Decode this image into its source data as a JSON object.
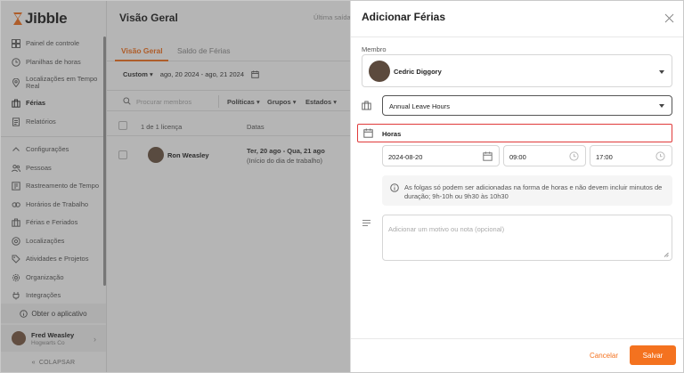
{
  "brand": {
    "name": "Jibble",
    "accent": "#f4721f"
  },
  "sidebar": {
    "items": [
      {
        "label": "Painel de controle",
        "icon": "dashboard-icon"
      },
      {
        "label": "Planilhas de horas",
        "icon": "clock-icon"
      },
      {
        "label": "Localizações em Tempo Real",
        "icon": "location-icon"
      },
      {
        "label": "Férias",
        "icon": "suitcase-icon",
        "active": true
      },
      {
        "label": "Relatórios",
        "icon": "report-icon"
      }
    ],
    "settings_items": [
      {
        "label": "Configurações",
        "icon": "chevron-up-icon"
      },
      {
        "label": "Pessoas",
        "icon": "people-icon"
      },
      {
        "label": "Rastreamento de Tempo",
        "icon": "tracking-icon"
      },
      {
        "label": "Horários de Trabalho",
        "icon": "schedule-icon"
      },
      {
        "label": "Férias e Feriados",
        "icon": "suitcase-icon"
      },
      {
        "label": "Localizações",
        "icon": "location-icon"
      },
      {
        "label": "Atividades e Projetos",
        "icon": "tag-icon"
      },
      {
        "label": "Organização",
        "icon": "gear-icon"
      },
      {
        "label": "Integrações",
        "icon": "plug-icon"
      }
    ],
    "get_app": "Obter o aplicativo",
    "user": {
      "name": "Fred Weasley",
      "org": "Hogwarts Co"
    },
    "collapse": "COLAPSAR"
  },
  "main": {
    "title": "Visão Geral",
    "last_updated": "Última saída",
    "tabs": [
      "Visão Geral",
      "Saldo de Férias"
    ],
    "period_mode": "Custom",
    "period_range": "ago, 20 2024 - ago, 21 2024",
    "search_placeholder": "Procurar membros",
    "filters": [
      "Políticas",
      "Grupos",
      "Estados"
    ],
    "table": {
      "count_label": "1 de 1 licença",
      "date_header": "Datas",
      "rows": [
        {
          "name": "Ron Weasley",
          "date_line1": "Ter, 20 ago - Qua, 21 ago",
          "date_line2": "(Início do dia de trabalho)"
        }
      ]
    }
  },
  "panel": {
    "title": "Adicionar Férias",
    "member_label": "Membro",
    "member_name": "Cedric Diggory",
    "policy": "Annual Leave Hours",
    "mode": "Horas",
    "date": "2024-08-20",
    "start_time": "09:00",
    "end_time": "17:00",
    "info": "As folgas só podem ser adicionadas na forma de horas e não devem incluir minutos de duração; 9h-10h ou 9h30 às 10h30",
    "note_placeholder": "Adicionar um motivo ou nota (opcional)",
    "cancel": "Cancelar",
    "save": "Salvar"
  }
}
